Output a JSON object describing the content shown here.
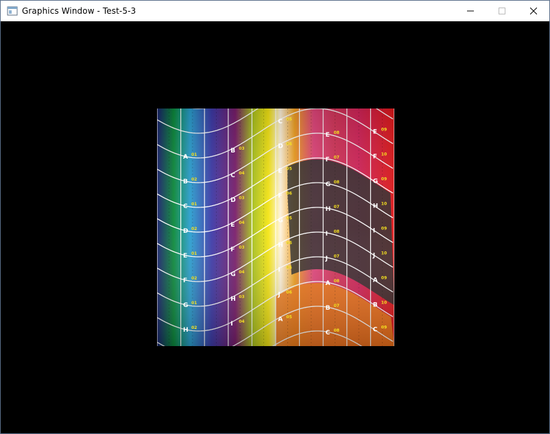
{
  "window": {
    "title": "Graphics Window - Test-5-3",
    "icon": "app-window-icon",
    "controls": {
      "minimize": "minimize-icon",
      "maximize": "maximize-icon",
      "close": "close-icon"
    }
  },
  "viewport": {
    "background": "#000000",
    "texture": {
      "description_colors": [
        "#1b1f6b",
        "#0a8a3a",
        "#2aa3c8",
        "#2455b5",
        "#f5e616",
        "#fff0d8",
        "#e43c7a",
        "#f07a18",
        "#d11b1b",
        "#2a2a2a"
      ],
      "row_letters": [
        "A",
        "B",
        "C",
        "D",
        "E",
        "F",
        "G",
        "H",
        "I",
        "J"
      ],
      "column_codes": [
        "01",
        "02",
        "03",
        "04",
        "05",
        "06",
        "07",
        "08",
        "09",
        "10"
      ]
    }
  }
}
